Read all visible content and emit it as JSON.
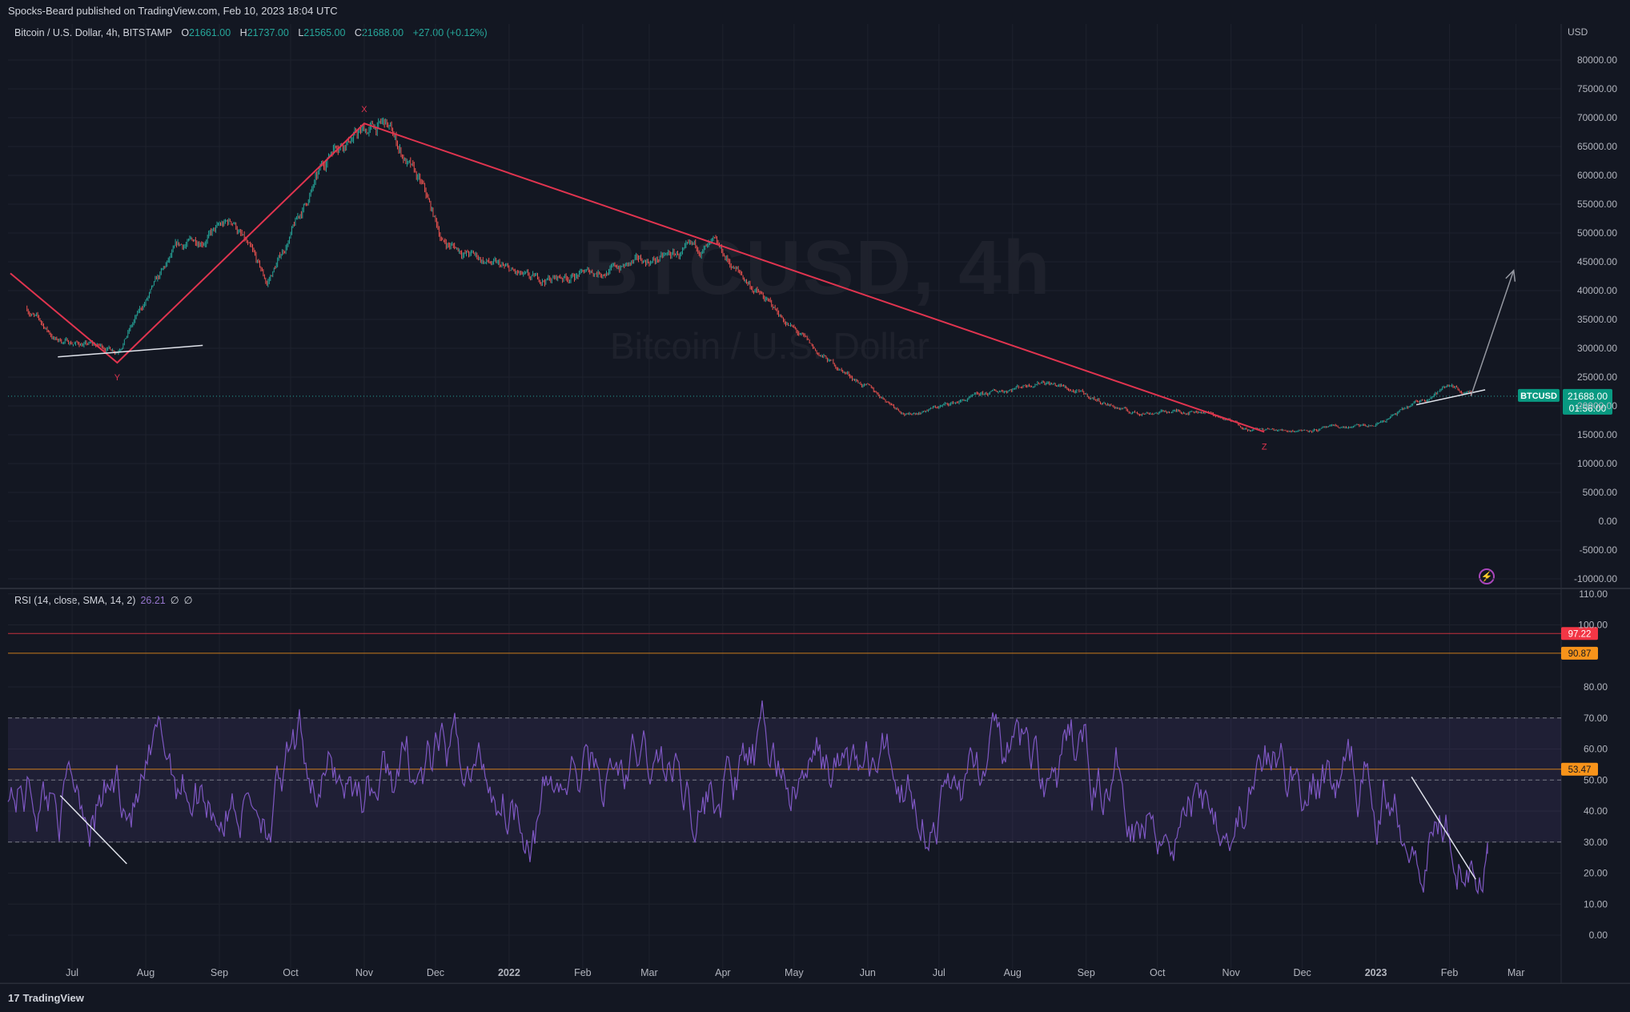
{
  "header": {
    "published": "Spocks-Beard published on TradingView.com, Feb 10, 2023 18:04 UTC"
  },
  "symbol": {
    "title": "Bitcoin / U.S. Dollar, 4h, BITSTAMP",
    "open_label": "O",
    "open": "21661.00",
    "high_label": "H",
    "high": "21737.00",
    "low_label": "L",
    "low": "21565.00",
    "close_label": "C",
    "close": "21688.00",
    "change": "+27.00 (+0.12%)",
    "watermark_big": "BTCUSD, 4h",
    "watermark_small": "Bitcoin / U.S. Dollar"
  },
  "price_axis": {
    "currency": "USD",
    "last_price_tag": "21688.00",
    "countdown": "01:56:00",
    "ticker_tag": "BTCUSD"
  },
  "rsi": {
    "legend": "RSI (14, close, SMA, 14, 2)",
    "value": "26.21",
    "sym1": "∅",
    "sym2": "∅",
    "tags": [
      "97.22",
      "90.87",
      "53.47"
    ]
  },
  "time_axis": {
    "labels": [
      "Jul",
      "Aug",
      "Sep",
      "Oct",
      "Nov",
      "Dec",
      "2022",
      "Feb",
      "Mar",
      "Apr",
      "May",
      "Jun",
      "Jul",
      "Aug",
      "Sep",
      "Oct",
      "Nov",
      "Dec",
      "2023",
      "Feb",
      "Mar"
    ]
  },
  "pattern_labels": [
    "X",
    "Y",
    "Z"
  ],
  "footer": {
    "brand": "TradingView",
    "logo_glyph": "17"
  },
  "colors": {
    "background": "#131722",
    "up": "#26a69a",
    "down": "#ef5350",
    "pattern_line": "#e0344f",
    "rsi_line": "#7e57c2",
    "rsi_band": "#7e57c2",
    "tag_red": "#f23645",
    "tag_orange": "#f7931a",
    "tag_green": "#089981"
  },
  "chart_data": [
    {
      "type": "line",
      "title": "Bitcoin / U.S. Dollar, 4h, BITSTAMP",
      "y_ticks": [
        80000,
        75000,
        70000,
        65000,
        60000,
        55000,
        50000,
        45000,
        40000,
        35000,
        30000,
        25000,
        20000,
        15000,
        10000,
        5000,
        0,
        -5000,
        -10000
      ],
      "ylim": [
        -10000,
        82000
      ],
      "series": [
        {
          "x": [
            "2021-06-12",
            "2021-06-24",
            "2021-07-20",
            "2021-08-14",
            "2021-09-07",
            "2021-09-21",
            "2021-10-20",
            "2021-11-10",
            "2021-11-26",
            "2021-12-04",
            "2022-01-10",
            "2022-02-10",
            "2022-03-28",
            "2022-05-11",
            "2022-06-18",
            "2022-08-14",
            "2022-09-20",
            "2022-10-20",
            "2022-11-09",
            "2022-11-21",
            "2022-12-31",
            "2023-01-13",
            "2023-02-02",
            "2023-02-10"
          ],
          "values": [
            37000,
            31500,
            29800,
            47000,
            52000,
            41000,
            66000,
            68800,
            57000,
            48500,
            41500,
            43500,
            47500,
            29000,
            18500,
            24500,
            18800,
            19200,
            16000,
            15700,
            16500,
            19300,
            23800,
            21688
          ]
        }
      ],
      "annotations": {
        "pattern": [
          {
            "label": "",
            "x": "2021-06-05",
            "y": 43000
          },
          {
            "label": "Y",
            "x": "2021-07-20",
            "y": 27500
          },
          {
            "label": "X",
            "x": "2021-11-01",
            "y": 69000
          },
          {
            "label": "Z",
            "x": "2022-11-15",
            "y": 15500
          }
        ],
        "support_line": [
          {
            "x": "2021-06-25",
            "y": 28500
          },
          {
            "x": "2021-08-25",
            "y": 30500
          }
        ],
        "recent_support": [
          {
            "x": "2023-01-18",
            "y": 20200
          },
          {
            "x": "2023-02-16",
            "y": 22800
          }
        ],
        "projection_arrow": [
          {
            "x": "2023-02-10",
            "y": 21700
          },
          {
            "x": "2023-02-28",
            "y": 43500
          }
        ]
      },
      "last_price": 21688
    },
    {
      "type": "line",
      "title": "RSI (14, close, SMA, 14, 2)",
      "y_ticks": [
        110,
        100,
        80,
        70,
        60,
        50,
        40,
        30,
        20,
        10,
        0
      ],
      "ylim": [
        -5,
        112
      ],
      "band": [
        30,
        70
      ],
      "middle": 50,
      "horizontal_lines": [
        97.22,
        90.87,
        53.47
      ],
      "last_value": 26.21,
      "trendlines": [
        [
          {
            "x": "2021-06-26",
            "y": 45
          },
          {
            "x": "2021-07-24",
            "y": 23
          }
        ],
        [
          {
            "x": "2023-01-16",
            "y": 51
          },
          {
            "x": "2023-02-12",
            "y": 18
          }
        ]
      ]
    }
  ]
}
